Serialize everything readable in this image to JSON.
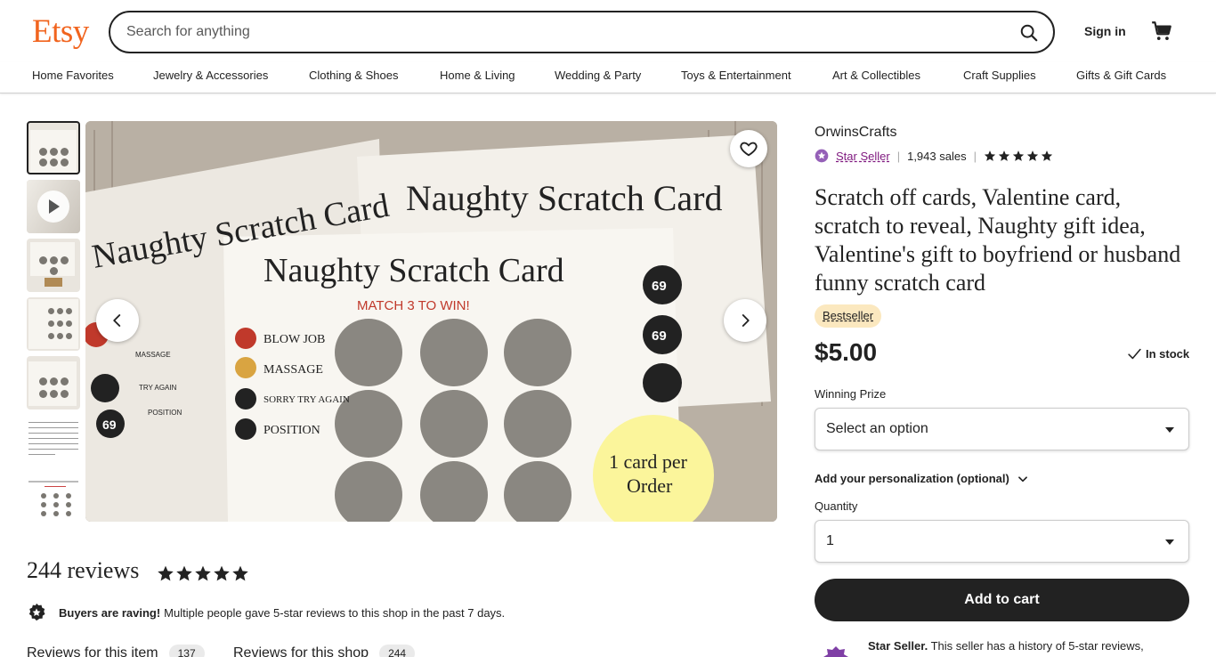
{
  "header": {
    "logo": "Etsy",
    "search_placeholder": "Search for anything",
    "sign_in": "Sign in"
  },
  "nav": [
    "Home Favorites",
    "Jewelry & Accessories",
    "Clothing & Shoes",
    "Home & Living",
    "Wedding & Party",
    "Toys & Entertainment",
    "Art & Collectibles",
    "Craft Supplies",
    "Gifts & Gift Cards"
  ],
  "listing": {
    "shop_name": "OrwinsCrafts",
    "star_seller": "Star Seller",
    "sales": "1,943 sales",
    "rating_stars": 5,
    "title": "Scratch off cards, Valentine card, scratch to reveal, Naughty gift idea, Valentine's gift to boyfriend or husband funny scratch card",
    "badge": "Bestseller",
    "price": "$5.00",
    "stock": "In stock",
    "option_label": "Winning Prize",
    "option_value": "Select an option",
    "personalization": "Add your personalization (optional)",
    "quantity_label": "Quantity",
    "quantity_value": "1",
    "add_to_cart": "Add to cart",
    "star_seller_note_bold": "Star Seller.",
    "star_seller_note": "This seller has a history of 5-star reviews,"
  },
  "image": {
    "card_title": "Naughty Scratch Card",
    "match_text": "MATCH 3 TO WIN!",
    "prizes": [
      "BLOW JOB",
      "MASSAGE",
      "SORRY TRY AGAIN",
      "POSITION"
    ],
    "side_numbers": [
      "69",
      "69"
    ],
    "back_left_labels": [
      "MASSAGE",
      "TRY AGAIN",
      "POSITION"
    ],
    "back_left_number": "69",
    "promo": [
      "1 card per",
      "Order"
    ]
  },
  "reviews": {
    "title": "244 reviews",
    "stars": 5,
    "raving_bold": "Buyers are raving!",
    "raving_text": "Multiple people gave 5-star reviews to this shop in the past 7 days.",
    "tab_item": "Reviews for this item",
    "tab_item_count": "137",
    "tab_shop": "Reviews for this shop",
    "tab_shop_count": "244"
  }
}
